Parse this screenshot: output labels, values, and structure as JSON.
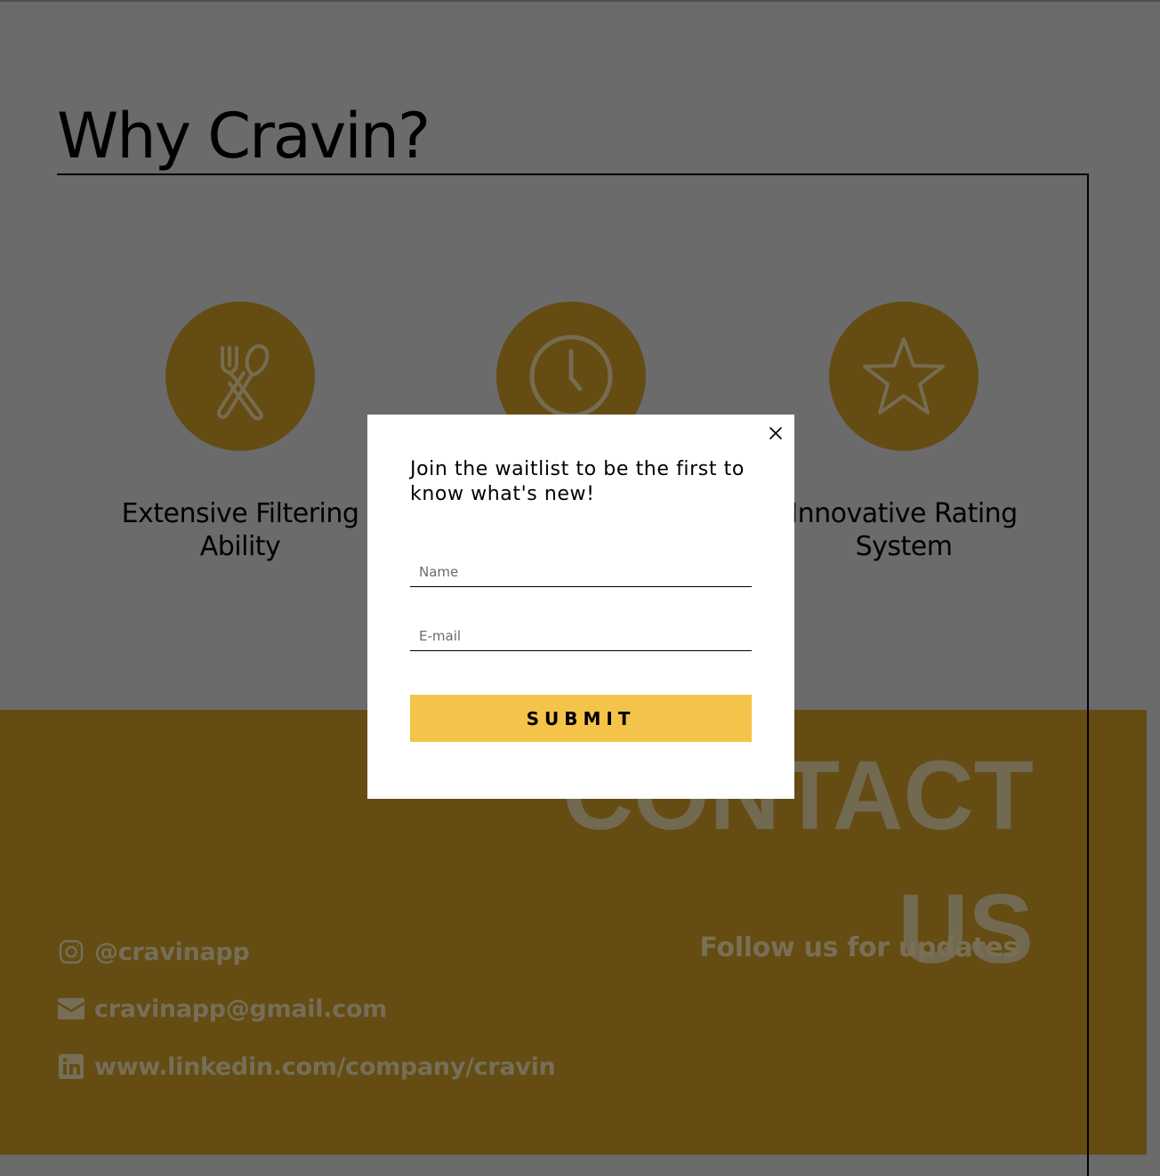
{
  "why_section": {
    "title": "Why Cravin?",
    "features": [
      {
        "icon": "utensils-icon",
        "label": "Extensive Filtering Ability"
      },
      {
        "icon": "clock-icon",
        "label": ""
      },
      {
        "icon": "star-icon",
        "label": "Innovative Rating System"
      }
    ]
  },
  "contact_section": {
    "heading_line1": "CONTACT",
    "heading_line2": "US",
    "follow_text": "Follow us for updates",
    "instagram": "@cravinapp",
    "email": "cravinapp@gmail.com",
    "linkedin": "www.linkedin.com/company/cravin"
  },
  "modal": {
    "title": "Join the waitlist to be the first to know what's new!",
    "name_placeholder": "Name",
    "name_value": "",
    "email_placeholder": "E-mail",
    "email_value": "",
    "submit_label": "SUBMIT",
    "close_icon": "close-icon"
  },
  "colors": {
    "accent_gold": "#c99826",
    "button_yellow": "#f4c34a",
    "overlay": "rgba(0,0,0,0.5)"
  }
}
